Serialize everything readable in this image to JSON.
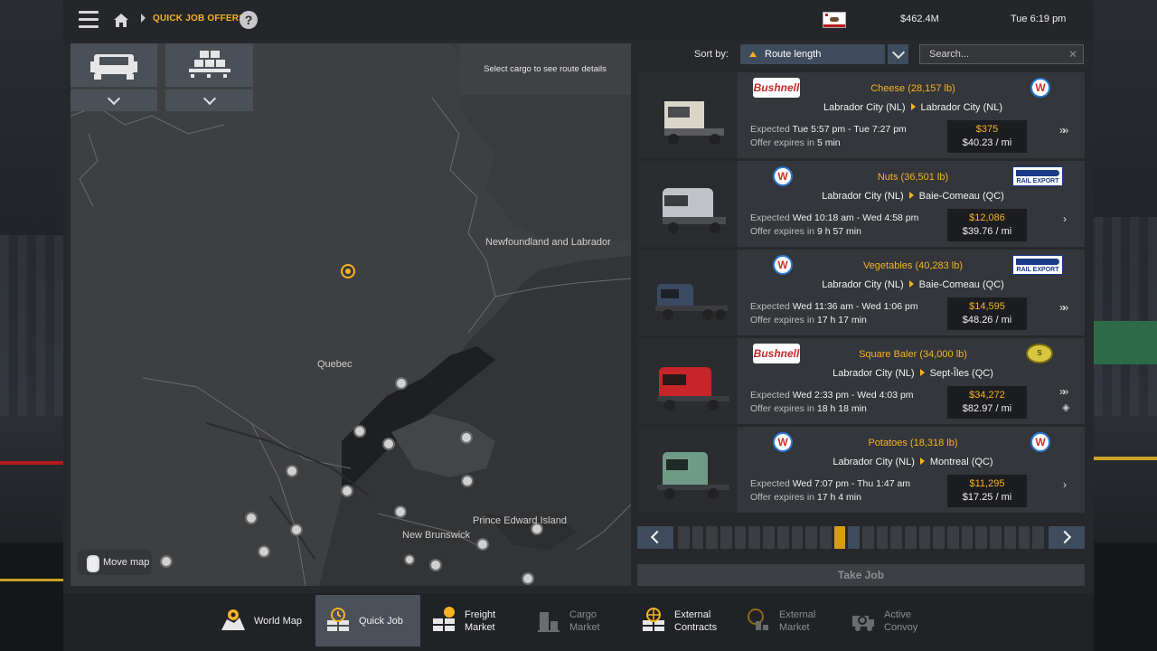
{
  "header": {
    "breadcrumb": "QUICK JOB OFFERS",
    "help_label": "?",
    "money": "$462.4M",
    "time": "Tue 6:19 pm"
  },
  "map": {
    "route_hint": "Select cargo to see route details",
    "labels": {
      "newfoundland": "Newfoundland and Labrador",
      "quebec": "Quebec",
      "new_brunswick": "New Brunswick",
      "pei": "Prince Edward Island"
    },
    "move_map": "Move map"
  },
  "sort": {
    "label": "Sort by:",
    "value": "Route length"
  },
  "search": {
    "placeholder": "Search..."
  },
  "jobs": [
    {
      "cargo": "Cheese (28,157 lb)",
      "from": "Labrador City (NL)",
      "to": "Labrador City (NL)",
      "expected_label": "Expected",
      "expected": "Tue 5:57 pm - Tue 7:27 pm",
      "offer_label": "Offer expires in",
      "offer": "5 min",
      "pay": "$375",
      "rate": "$40.23 / mi",
      "logo_left": "Bushnell",
      "logo_right": "W",
      "urgency": "»»"
    },
    {
      "cargo": "Nuts (36,501 lb)",
      "from": "Labrador City (NL)",
      "to": "Baie-Comeau (QC)",
      "expected_label": "Expected",
      "expected": "Wed 10:18 am - Wed 4:58 pm",
      "offer_label": "Offer expires in",
      "offer": "9 h 57 min",
      "pay": "$12,086",
      "rate": "$39.76 / mi",
      "logo_left": "W",
      "logo_right": "RAIL EXPORT",
      "urgency": "›"
    },
    {
      "cargo": "Vegetables (40,283 lb)",
      "from": "Labrador City (NL)",
      "to": "Baie-Comeau (QC)",
      "expected_label": "Expected",
      "expected": "Wed 11:36 am - Wed 1:06 pm",
      "offer_label": "Offer expires in",
      "offer": "17 h 17 min",
      "pay": "$14,595",
      "rate": "$48.26 / mi",
      "logo_left": "W",
      "logo_right": "RAIL EXPORT",
      "urgency": "»»"
    },
    {
      "cargo": "Square Baler (34,000 lb)",
      "from": "Labrador City (NL)",
      "to": "Sept-Îles (QC)",
      "expected_label": "Expected",
      "expected": "Wed 2:33 pm - Wed 4:03 pm",
      "offer_label": "Offer expires in",
      "offer": "18 h 18 min",
      "pay": "$34,272",
      "rate": "$82.97 / mi",
      "logo_left": "Bushnell",
      "logo_right": "S",
      "urgency": "»»"
    },
    {
      "cargo": "Potatoes (18,318 lb)",
      "from": "Labrador City (NL)",
      "to": "Montreal (QC)",
      "expected_label": "Expected",
      "expected": "Wed 7:07 pm - Thu 1:47 am",
      "offer_label": "Offer expires in",
      "offer": "17 h 4 min",
      "pay": "$11,295",
      "rate": "$17.25 / mi",
      "logo_left": "W",
      "logo_right": "W",
      "urgency": "›"
    }
  ],
  "take_job": "Take Job",
  "nav": {
    "world_map": "World Map",
    "quick_job": "Quick Job",
    "freight_market_1": "Freight",
    "freight_market_2": "Market",
    "cargo_market_1": "Cargo",
    "cargo_market_2": "Market",
    "external_contracts_1": "External",
    "external_contracts_2": "Contracts",
    "external_market_1": "External",
    "external_market_2": "Market",
    "active_convoy_1": "Active",
    "active_convoy_2": "Convoy"
  },
  "colors": {
    "accent": "#f5b324",
    "button": "#3e4c5e",
    "card": "#33363a"
  }
}
